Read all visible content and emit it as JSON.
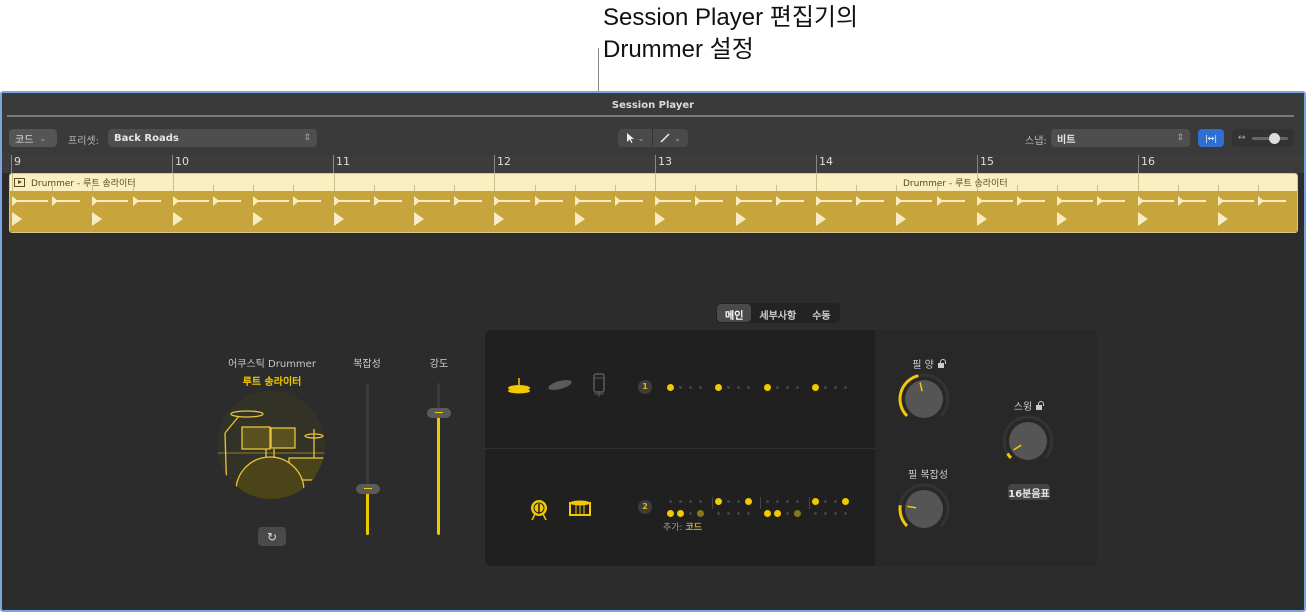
{
  "callout": {
    "line1": "Session Player 편집기의",
    "line2": "Drummer 설정"
  },
  "window": {
    "title": "Session Player"
  },
  "toolbar": {
    "mode_button": "코드",
    "preset_label": "프리셋:",
    "preset_value": "Back Roads",
    "pointer_tool": "pointer-tool",
    "pencil_tool": "pencil-tool",
    "snap_label": "스냅:",
    "snap_value": "비트",
    "fit_button": "|↔|",
    "zoom_icon": "↔",
    "zoom_level": 0.6
  },
  "ruler": {
    "bars": [
      "9",
      "10",
      "11",
      "12",
      "13",
      "14",
      "15",
      "16"
    ]
  },
  "region": {
    "label_start": "Drummer - 루트 송라이터",
    "label_end": "Drummer - 루트 송라이터",
    "color": "#c8a53c"
  },
  "tabs": [
    {
      "label": "메인",
      "active": true
    },
    {
      "label": "세부사항",
      "active": false
    },
    {
      "label": "수동",
      "active": false
    }
  ],
  "drummer": {
    "genre": "어쿠스틱 Drummer",
    "name": "루트 송라이터",
    "refresh_icon": "refresh-icon"
  },
  "sliders": {
    "complexity": {
      "label": "복잡성",
      "value": 0.3
    },
    "loudness": {
      "label": "강도",
      "value": 0.8
    }
  },
  "pattern_rows": [
    {
      "number": "1",
      "instruments": [
        "hihat",
        "ride-cymbal",
        "percussion-shaker"
      ],
      "active_instrument": "hihat"
    },
    {
      "number": "2",
      "instruments": [
        "kick-drum",
        "snare-drum"
      ],
      "active_instrument": "kick-snare",
      "add_label": "추가:",
      "add_value": "코드"
    }
  ],
  "knobs": {
    "fill_amount": {
      "label": "필 양",
      "value": 0.45,
      "locked": false
    },
    "fill_complexity": {
      "label": "필 복잡성",
      "value": 0.2,
      "locked": false
    },
    "swing": {
      "label": "스윙",
      "value": 0.05,
      "locked": false,
      "resolution": "16분음표"
    }
  },
  "accent_color": "#f2c800"
}
